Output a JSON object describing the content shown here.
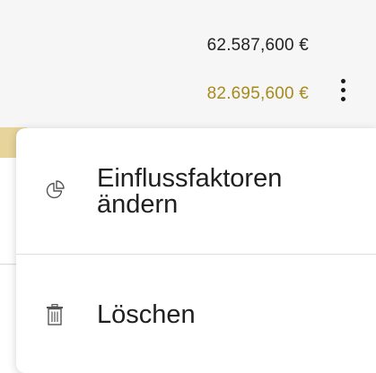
{
  "amounts": {
    "primary": "62.587,600 €",
    "secondary": "82.695,600 €"
  },
  "colors": {
    "secondary_amount": "#a88a1c",
    "accent_strip": "#e6d49a"
  },
  "menu": {
    "items": [
      {
        "label": "Einflussfaktoren ändern",
        "icon": "pie-chart-icon"
      },
      {
        "label": "Löschen",
        "icon": "trash-icon"
      }
    ]
  },
  "icons": {
    "kebab": "more-vertical-icon"
  }
}
